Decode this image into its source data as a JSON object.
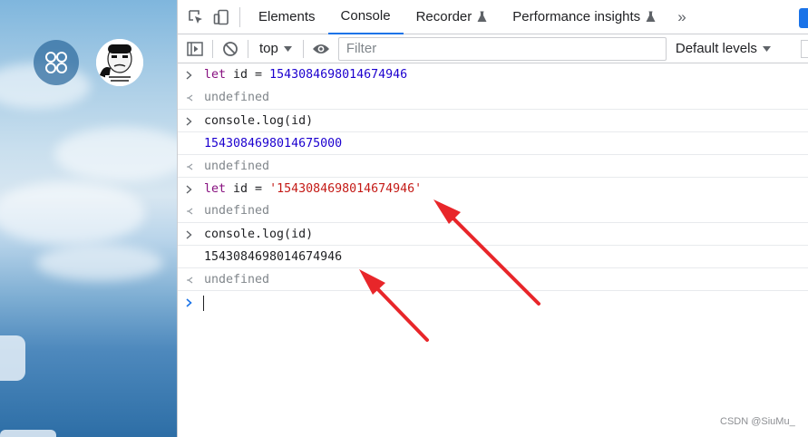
{
  "devtools": {
    "tabs": [
      {
        "label": "Elements",
        "active": false
      },
      {
        "label": "Console",
        "active": true
      },
      {
        "label": "Recorder",
        "active": false,
        "icon": "flask-icon"
      },
      {
        "label": "Performance insights",
        "active": false,
        "icon": "flask-icon"
      }
    ],
    "more_tabs_glyph": "»",
    "toolbar": {
      "context": "top",
      "filter_placeholder": "Filter",
      "levels": "Default levels"
    },
    "accent_color": "#1a73e8"
  },
  "console": {
    "entries": [
      {
        "type": "input",
        "segments": [
          "let",
          " id = ",
          "1543084698014674946"
        ]
      },
      {
        "type": "result",
        "text": "undefined"
      },
      {
        "type": "input",
        "text": "console.log(id)"
      },
      {
        "type": "log",
        "text": "1543084698014675000"
      },
      {
        "type": "result",
        "text": "undefined"
      },
      {
        "type": "input",
        "segments": [
          "let",
          " id = ",
          "'1543084698014674946'"
        ]
      },
      {
        "type": "result",
        "text": "undefined"
      },
      {
        "type": "input",
        "text": "console.log(id)"
      },
      {
        "type": "log",
        "text": "1543084698014674946"
      },
      {
        "type": "result",
        "text": "undefined"
      }
    ],
    "colors": {
      "keyword": "#881280",
      "number": "#1c00cf",
      "string": "#c41a16",
      "muted": "#80868b"
    }
  },
  "annotations": {
    "arrow_color": "#e8262a"
  },
  "watermark": "CSDN @SiuMu_"
}
